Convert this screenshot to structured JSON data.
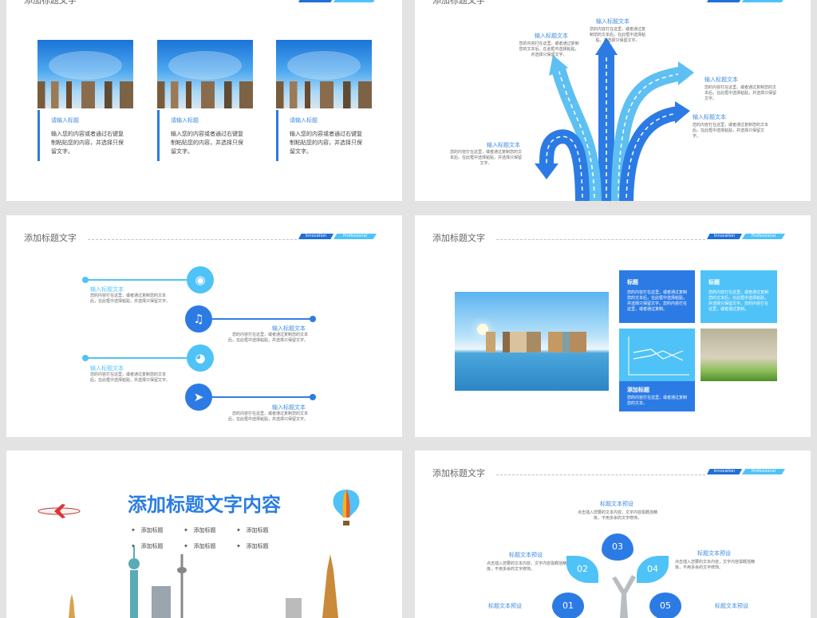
{
  "header": {
    "title": "添加标题文字",
    "tag_innovation": "Innovation",
    "tag_professional": "Professional"
  },
  "slide1": {
    "cards": [
      {
        "heading": "请输入标题",
        "text": "输入您的内容或者通过右键复制粘贴您的内容，并选择只保留文字。"
      },
      {
        "heading": "请输入标题",
        "text": "输入您的内容或者通过右键复制粘贴您的内容，并选择只保留文字。"
      },
      {
        "heading": "请输入标题",
        "text": "输入您的内容或者通过右键复制粘贴您的内容，并选择只保留文字。"
      }
    ]
  },
  "slide2": {
    "items": [
      {
        "title": "输入标题文本",
        "text": "您的内容打在这里，或者通过复制您的文本后，在此框中选择粘贴，并选择只保留文字。"
      },
      {
        "title": "输入标题文本",
        "text": "您的内容打在这里，或者通过复制您的文本后，在此框中选择粘贴，并选择只保留文字。"
      },
      {
        "title": "输入标题文本",
        "text": "您的内容打在这里，或者通过复制您的文本后，在此框中选择粘贴，并选择只保留文字。"
      },
      {
        "title": "输入标题文本",
        "text": "您的内容打在这里，或者通过复制您的文本后，在此框中选择粘贴，并选择只保留文字。"
      },
      {
        "title": "输入标题文本",
        "text": "您的内容打在这里，或者通过复制您的文本后，在此框中选择粘贴，并选择只保留文字。"
      }
    ]
  },
  "slide3": {
    "items": [
      {
        "title": "输入标题文本",
        "text": "您的内容打在这里，或者通过复制您的文本后，在此框中选择粘贴，并选择只保留文字。",
        "icon": "camera-icon"
      },
      {
        "title": "输入标题文本",
        "text": "您的内容打在这里，或者通过复制您的文本后，在此框中选择粘贴，并选择只保留文字。",
        "icon": "music-icon"
      },
      {
        "title": "输入标题文本",
        "text": "您的内容打在这里，或者通过复制您的文本后，在此框中选择粘贴，并选择只保留文字。",
        "icon": "gauge-icon"
      },
      {
        "title": "输入标题文本",
        "text": "您的内容打在这里，或者通过复制您的文本后，在此框中选择粘贴，并选择只保留文字。",
        "icon": "rocket-icon"
      }
    ]
  },
  "slide4": {
    "box1": {
      "heading": "标题",
      "text": "您的内容打在这里，或者通过复制您的文本后，在此框中选择粘贴，并选择只保留文字。您的内容打在这里，或者通过复制。"
    },
    "box2": {
      "heading": "标题",
      "text": "您的内容打在这里，或者通过复制您的文本后，在此框中选择粘贴，并选择只保留文字。您的内容打在这里，或者通过复制。"
    },
    "box3": {
      "heading": "添加标题",
      "text": "您的内容打在这里，或者通过复制您的文本。"
    }
  },
  "slide5": {
    "title": "添加标题文字内容",
    "bullets": [
      "添加标题",
      "添加标题",
      "添加标题",
      "添加标题",
      "添加标题",
      "添加标题"
    ]
  },
  "slide6": {
    "labels": [
      "标题文本预设",
      "标题文本预设",
      "标题文本预设",
      "标题文本预设",
      "标题文本预设"
    ],
    "desc": "点击插入您要的文本内容，文字内容需概括精炼，不用多余的文字修饰。",
    "numbers": [
      "01",
      "02",
      "03",
      "04",
      "05"
    ]
  },
  "colors": {
    "primary": "#2c7be5",
    "light": "#4fc3f7",
    "title_blue": "#2a7de1"
  }
}
